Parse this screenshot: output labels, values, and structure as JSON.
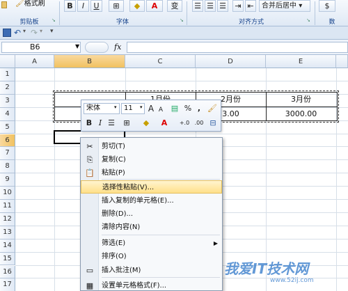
{
  "ribbon": {
    "format_painter_label": "格式刷",
    "font_buttons": [
      "B",
      "I",
      "U"
    ],
    "font_color_letter": "A",
    "wen_label": "变",
    "merge_label": "合并后居中",
    "groups": {
      "clipboard": "剪贴板",
      "font": "字体",
      "alignment": "对齐方式",
      "number": "数"
    }
  },
  "qat": {
    "icons": [
      "save-icon",
      "undo-icon",
      "redo-icon",
      "customize-icon"
    ]
  },
  "formula_bar": {
    "name_box": "B6",
    "fx": "fx",
    "formula": ""
  },
  "sheet": {
    "columns": [
      "A",
      "B",
      "C",
      "D",
      "E"
    ],
    "rows": [
      "1",
      "2",
      "3",
      "4",
      "5",
      "6",
      "7",
      "8",
      "9",
      "10",
      "11",
      "12",
      "13",
      "14",
      "15",
      "16",
      "17",
      "18"
    ],
    "selected_column": "B",
    "selected_row": "6",
    "cells": {
      "c3": "1月份",
      "d3": "2月份",
      "e3": "3月份",
      "d4": "3.00",
      "e4": "3000.00"
    }
  },
  "mini_toolbar": {
    "font_name": "宋体",
    "font_size": "11",
    "grow_font": "A",
    "shrink_font": "A",
    "percent": "%",
    "comma": ",",
    "bold": "B",
    "italic": "I",
    "font_color": "A",
    "inc_decimal": "+.0",
    "dec_decimal": ".00"
  },
  "context_menu": {
    "items": [
      {
        "label": "剪切(T)",
        "icon": "scissors-icon",
        "glyph": "✂"
      },
      {
        "label": "复制(C)",
        "icon": "copy-icon",
        "glyph": "⎘"
      },
      {
        "label": "粘贴(P)",
        "icon": "paste-icon",
        "glyph": "📋"
      },
      {
        "label": "选择性粘贴(V)...",
        "icon": "",
        "glyph": ""
      },
      {
        "label": "插入复制的单元格(E)...",
        "icon": "",
        "glyph": ""
      },
      {
        "label": "删除(D)...",
        "icon": "",
        "glyph": ""
      },
      {
        "label": "清除内容(N)",
        "icon": "",
        "glyph": ""
      },
      {
        "label": "筛选(E)",
        "icon": "",
        "glyph": ""
      },
      {
        "label": "排序(O)",
        "icon": "",
        "glyph": ""
      },
      {
        "label": "插入批注(M)",
        "icon": "comment-icon",
        "glyph": "▭"
      },
      {
        "label": "设置单元格格式(F)...",
        "icon": "format-cells-icon",
        "glyph": "▦"
      }
    ],
    "highlighted_index": 3
  },
  "watermark": {
    "text": "我爱IT技术网",
    "url": "www.52ij.com"
  },
  "colors": {
    "accent": "#15428b",
    "selection": "#f1c15f",
    "highlight": "#ffe08a"
  }
}
